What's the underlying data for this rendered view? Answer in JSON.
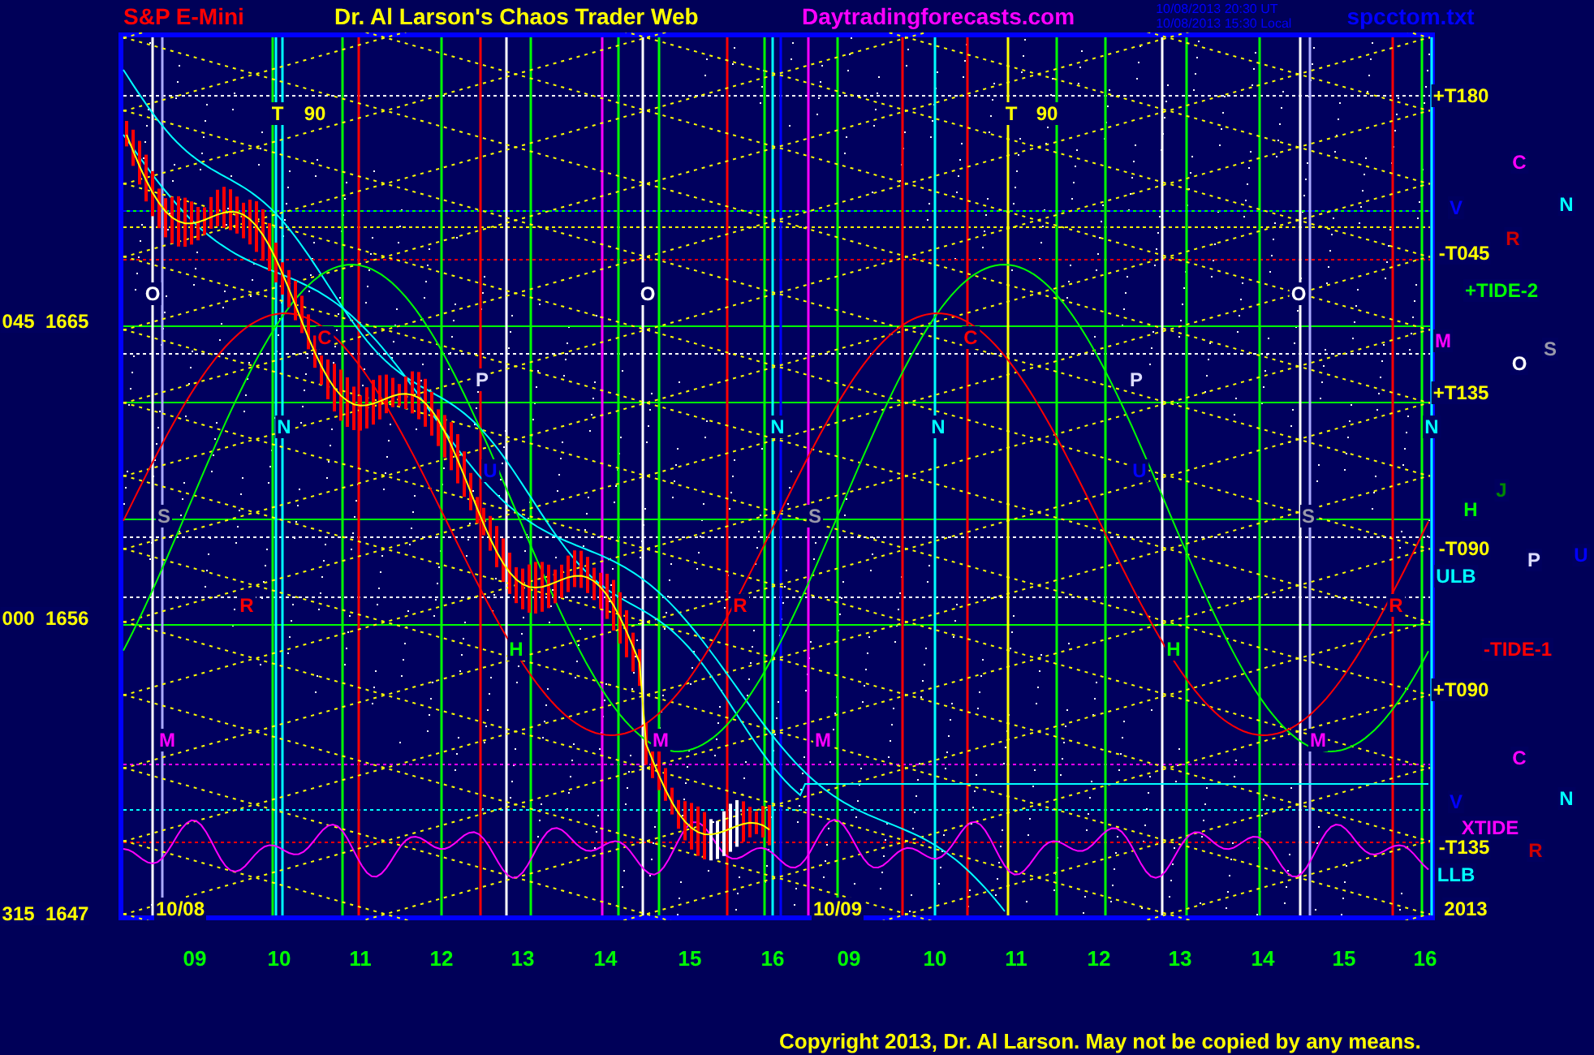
{
  "header": {
    "instrument": "S&P E-Mini",
    "title": "Dr. Al Larson's Chaos Trader Web",
    "site": "Daytradingforecasts.com",
    "timestamps": [
      "10/08/2013 20:30 UT",
      "10/08/2013 15:30 Local"
    ],
    "file": "spcctom.txt"
  },
  "y_axis_labels": [
    "045  1665",
    "000  1656",
    "315  1647"
  ],
  "markers": [
    {
      "text": "T",
      "color": "#ffff00"
    },
    {
      "text": "90",
      "color": "#ffff00"
    },
    {
      "text": "T",
      "color": "#ffff00"
    },
    {
      "text": "90",
      "color": "#ffff00"
    },
    {
      "text": "O",
      "color": "#ffffff"
    },
    {
      "text": "O",
      "color": "#ffffff"
    },
    {
      "text": "O",
      "color": "#ffffff"
    },
    {
      "text": "C",
      "color": "#ff0000"
    },
    {
      "text": "C",
      "color": "#ff0000"
    },
    {
      "text": "P",
      "color": "#ddddff"
    },
    {
      "text": "P",
      "color": "#ddddff"
    },
    {
      "text": "N",
      "color": "#00ffff"
    },
    {
      "text": "N",
      "color": "#00ffff"
    },
    {
      "text": "N",
      "color": "#00ffff"
    },
    {
      "text": "N",
      "color": "#00ffff"
    },
    {
      "text": "U",
      "color": "#0000ff"
    },
    {
      "text": "U",
      "color": "#0000ff"
    },
    {
      "text": "S",
      "color": "#9999aa"
    },
    {
      "text": "S",
      "color": "#9999aa"
    },
    {
      "text": "S",
      "color": "#9999aa"
    },
    {
      "text": "R",
      "color": "#ff0000"
    },
    {
      "text": "R",
      "color": "#ff0000"
    },
    {
      "text": "R",
      "color": "#ff0000"
    },
    {
      "text": "H",
      "color": "#00ff00"
    },
    {
      "text": "H",
      "color": "#00ff00"
    },
    {
      "text": "M",
      "color": "#ff00ff"
    },
    {
      "text": "M",
      "color": "#ff00ff"
    },
    {
      "text": "M",
      "color": "#ff00ff"
    },
    {
      "text": "M",
      "color": "#ff00ff"
    },
    {
      "text": "10/08",
      "color": "#ffff00"
    },
    {
      "text": "10/09",
      "color": "#ffff00"
    }
  ],
  "right_labels": [
    {
      "text": "+T180",
      "color": "#ffff00"
    },
    {
      "text": "C",
      "color": "#ff00ff"
    },
    {
      "text": "N",
      "color": "#00ffff"
    },
    {
      "text": "V",
      "color": "#0000ff"
    },
    {
      "text": "R",
      "color": "#cc0000"
    },
    {
      "text": "-T045",
      "color": "#ffff00"
    },
    {
      "text": "+TIDE-2",
      "color": "#00ff00"
    },
    {
      "text": "M",
      "color": "#ff00ff"
    },
    {
      "text": "S",
      "color": "#9999aa"
    },
    {
      "text": "O",
      "color": "#ffffff"
    },
    {
      "text": "+T135",
      "color": "#ffff00"
    },
    {
      "text": "J",
      "color": "#008800"
    },
    {
      "text": "H",
      "color": "#00ff00"
    },
    {
      "text": "-T090",
      "color": "#ffff00"
    },
    {
      "text": "P",
      "color": "#ddddff"
    },
    {
      "text": "U",
      "color": "#0000ff"
    },
    {
      "text": "ULB",
      "color": "#00ffff"
    },
    {
      "text": "-TIDE-1",
      "color": "#ff0000"
    },
    {
      "text": "+T090",
      "color": "#ffff00"
    },
    {
      "text": "C",
      "color": "#ff00ff"
    },
    {
      "text": "N",
      "color": "#00ffff"
    },
    {
      "text": "V",
      "color": "#0000ff"
    },
    {
      "text": "XTIDE",
      "color": "#ff00ff"
    },
    {
      "text": "R",
      "color": "#cc0000"
    },
    {
      "text": "-T135",
      "color": "#ffff00"
    },
    {
      "text": "LLB",
      "color": "#00ffff"
    },
    {
      "text": "2013",
      "color": "#ffff00"
    }
  ],
  "x_axis_labels": [
    "09",
    "10",
    "11",
    "12",
    "13",
    "14",
    "15",
    "16",
    "09",
    "10",
    "11",
    "12",
    "13",
    "14",
    "15",
    "16"
  ],
  "copyright": "Copyright 2013, Dr. Al Larson. May not be copied by any means."
}
